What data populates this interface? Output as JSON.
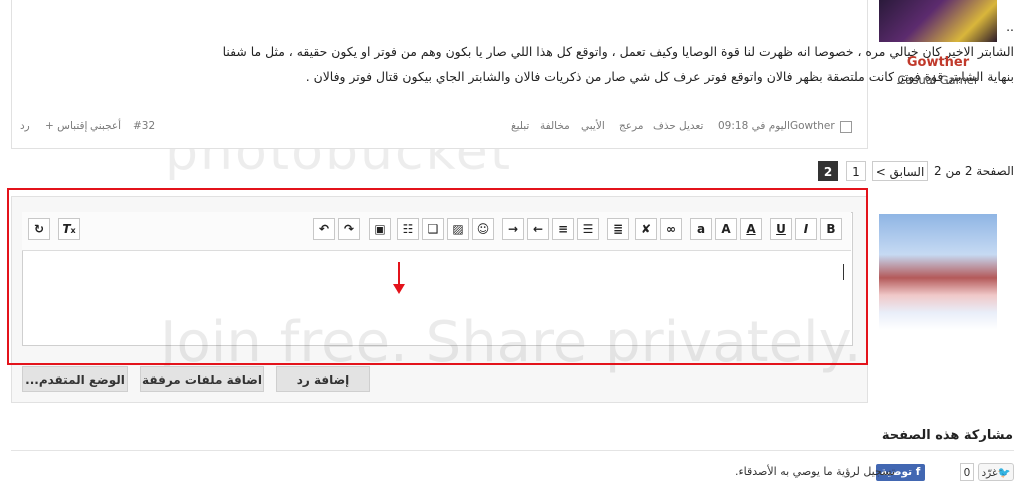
{
  "post": {
    "dots": "..",
    "line1": "الشابتر الاخير كان خيالي مره ، خصوصا انه ظهرت لنا قوة الوصايا وكيف تعمل ، واتوقع كل هذا اللي صار يا بكون وهم من فوتر او يكون حقيقه ، مثل ما شفنا",
    "line2": "بنهاية الشابتر قوة فوتر كانت ملتصقة بظهر فالان واتوقع فوتر عرف كل شي صار من ذكريات فالان والشابتر الجاي بيكون قتال فوتر وفالان .",
    "author": "Gowther",
    "time": "اليوم في 09:18",
    "actions": [
      "تعديل",
      "حذف",
      "مرعج",
      "الأيبي",
      "مخالفة",
      "تبليغ"
    ],
    "post_number": "#32",
    "like_label": "أعجبني",
    "quote_label": "+ إقتباس",
    "reply_label": "رد"
  },
  "user": {
    "name": "Gowther",
    "title": "Casual Gamer"
  },
  "pagination": {
    "label": "الصفحة 2 من 2",
    "prev": "< السابق",
    "pages": [
      "1",
      "2"
    ],
    "current": "2"
  },
  "editor": {
    "tools": [
      "B",
      "I",
      "U",
      "A",
      "A:",
      "aa",
      "link",
      "unlink",
      "align",
      "list-bullet",
      "list-number",
      "indent",
      "outdent",
      "emoji",
      "image",
      "gallery",
      "table",
      "save",
      "redo",
      "undo",
      "clear-format",
      "source"
    ]
  },
  "buttons": {
    "reply": "إضافة رد",
    "attach": "اضافة ملفات مرفقة",
    "advanced": "الوضع المتقدم..."
  },
  "share": {
    "title": "مشاركة هذه الصفحة",
    "fb_label": "توصية",
    "fb_text": "تسجيل لرؤية ما يوصي به الأصدقاء.",
    "tweet_label": "غرّد",
    "tweet_count": "0"
  },
  "watermark": {
    "line1": "photobucket",
    "line2": "Join free. Share privately."
  },
  "colors": {
    "red_frame": "#e3131b",
    "username": "#c0392b",
    "fb": "#4267b2"
  }
}
